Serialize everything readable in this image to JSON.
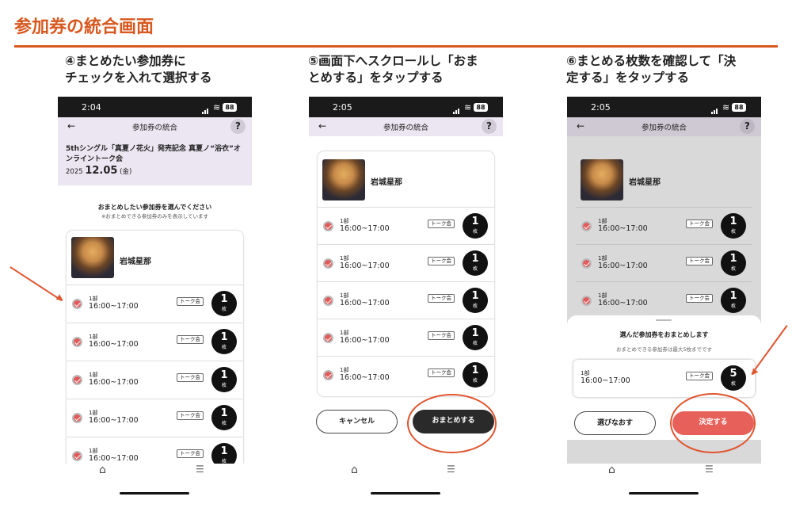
{
  "page_title": "参加券の統合画面",
  "steps": [
    {
      "line1": "④まとめたい参加券に",
      "line2": "チェックを入れて選択する"
    },
    {
      "line1": "⑤画面下へスクロールし「おま",
      "line2": "とめする」をタップする"
    },
    {
      "line1": "⑥まとめる枚数を確認して「決",
      "line2": "定する」をタップする"
    }
  ],
  "status": {
    "battery": "88",
    "times": [
      "2:04",
      "2:05",
      "2:05"
    ]
  },
  "nav": {
    "title": "参加券の統合",
    "back": "←",
    "help": "?"
  },
  "event": {
    "title": "5thシングル「真夏ノ花火」発売記念 真夏ノ“浴衣”オンライントーク会",
    "year": "2025",
    "date": "12.05",
    "weekday": "(金)"
  },
  "instructions": {
    "main": "おまとめしたい参加券を選んでください",
    "sub": "※おまとめできる参加券のみを表示しています"
  },
  "member": "岩城星那",
  "ticket": {
    "part": "1部",
    "time": "16:00~17:00",
    "tag": "トーク会",
    "count": "1",
    "unit": "枚"
  },
  "buttons": {
    "cancel": "キャンセル",
    "merge": "おまとめする",
    "reselect": "選びなおす",
    "confirm": "決定する"
  },
  "sheet": {
    "title": "選んだ参加券をおまとめします",
    "note": "おまとめできる参加券は最大5枚までです",
    "count": "5"
  },
  "colors": {
    "accent": "#d8581f",
    "header_bg": "#ece6f2",
    "confirm": "#e8605a"
  },
  "icons": [
    "home-icon",
    "menu-icon",
    "checkmark-icon",
    "back-arrow-icon",
    "help-icon",
    "wifi-icon",
    "battery-icon"
  ]
}
